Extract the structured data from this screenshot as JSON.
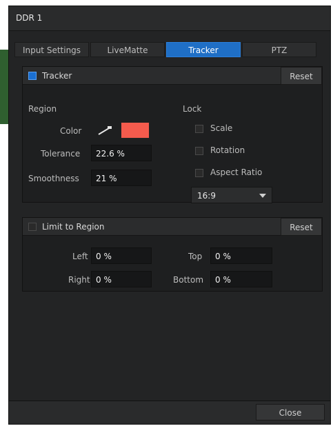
{
  "window": {
    "title": "DDR 1"
  },
  "tabs": [
    {
      "label": "Input Settings",
      "active": false
    },
    {
      "label": "LiveMatte",
      "active": false
    },
    {
      "label": "Tracker",
      "active": true
    },
    {
      "label": "PTZ",
      "active": false
    }
  ],
  "tracker": {
    "header_label": "Tracker",
    "enabled": true,
    "reset_label": "Reset",
    "region_label": "Region",
    "color_label": "Color",
    "color_value": "#f45b4d",
    "tolerance_label": "Tolerance",
    "tolerance_value": "22.6 %",
    "smoothness_label": "Smoothness",
    "smoothness_value": "21 %",
    "lock_label": "Lock",
    "lock_options": [
      {
        "label": "Scale",
        "checked": false
      },
      {
        "label": "Rotation",
        "checked": false
      },
      {
        "label": "Aspect Ratio",
        "checked": false
      }
    ],
    "aspect_select": {
      "value": "16:9"
    }
  },
  "limit_region": {
    "header_label": "Limit to Region",
    "enabled": false,
    "reset_label": "Reset",
    "left_label": "Left",
    "left_value": "0 %",
    "right_label": "Right",
    "right_value": "0 %",
    "top_label": "Top",
    "top_value": "0 %",
    "bottom_label": "Bottom",
    "bottom_value": "0 %"
  },
  "footer": {
    "close_label": "Close"
  },
  "colors": {
    "accent": "#1f6fc6",
    "panel_bg": "#1e1f20",
    "window_bg": "#232425"
  }
}
